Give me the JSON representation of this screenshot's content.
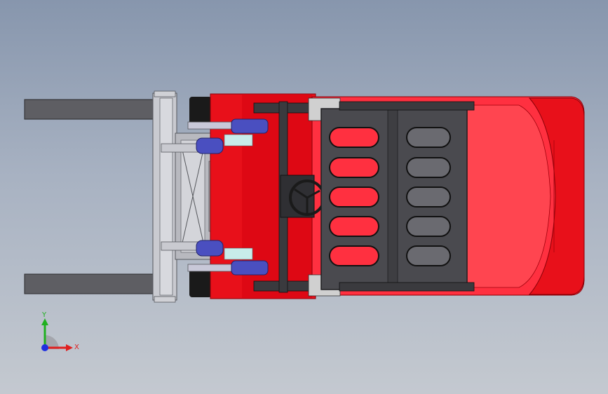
{
  "viewport": {
    "background_top": "#8796ad",
    "background_bottom": "#c4c9d0"
  },
  "model": {
    "description_colors": {
      "body": "#e8101a",
      "body_dark": "#b80010",
      "seat_frame": "#4a4a4f",
      "fork": "#5e5e63",
      "mast": "#c9cad0",
      "cylinder": "#4a4fc0"
    }
  },
  "triad": {
    "x_label": "X",
    "y_label": "Y",
    "x_color": "#e02020",
    "y_color": "#20b020",
    "z_color": "#2030e0"
  }
}
